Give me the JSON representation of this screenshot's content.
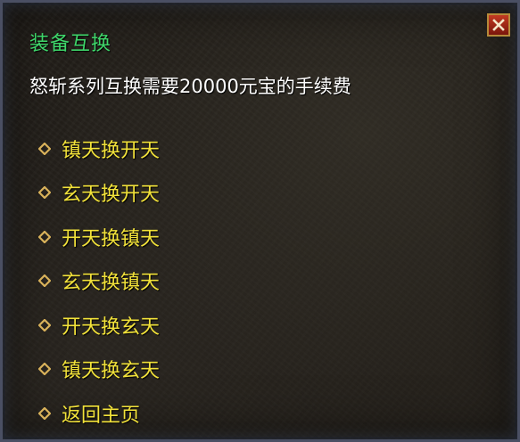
{
  "window": {
    "title": "装备互换",
    "description": "怒斩系列互换需要20000元宝的手续费"
  },
  "icons": {
    "close": "close-icon",
    "bullet": "diamond-icon"
  },
  "colors": {
    "title": "#3fd66a",
    "description": "#ffffff",
    "option": "#f2e23a",
    "bullet": "#d9b25a",
    "close_button": "#c23a22"
  },
  "options": [
    {
      "label": "镇天换开天"
    },
    {
      "label": "玄天换开天"
    },
    {
      "label": "开天换镇天"
    },
    {
      "label": "玄天换镇天"
    },
    {
      "label": "开天换玄天"
    },
    {
      "label": "镇天换玄天"
    },
    {
      "label": "返回主页"
    }
  ]
}
